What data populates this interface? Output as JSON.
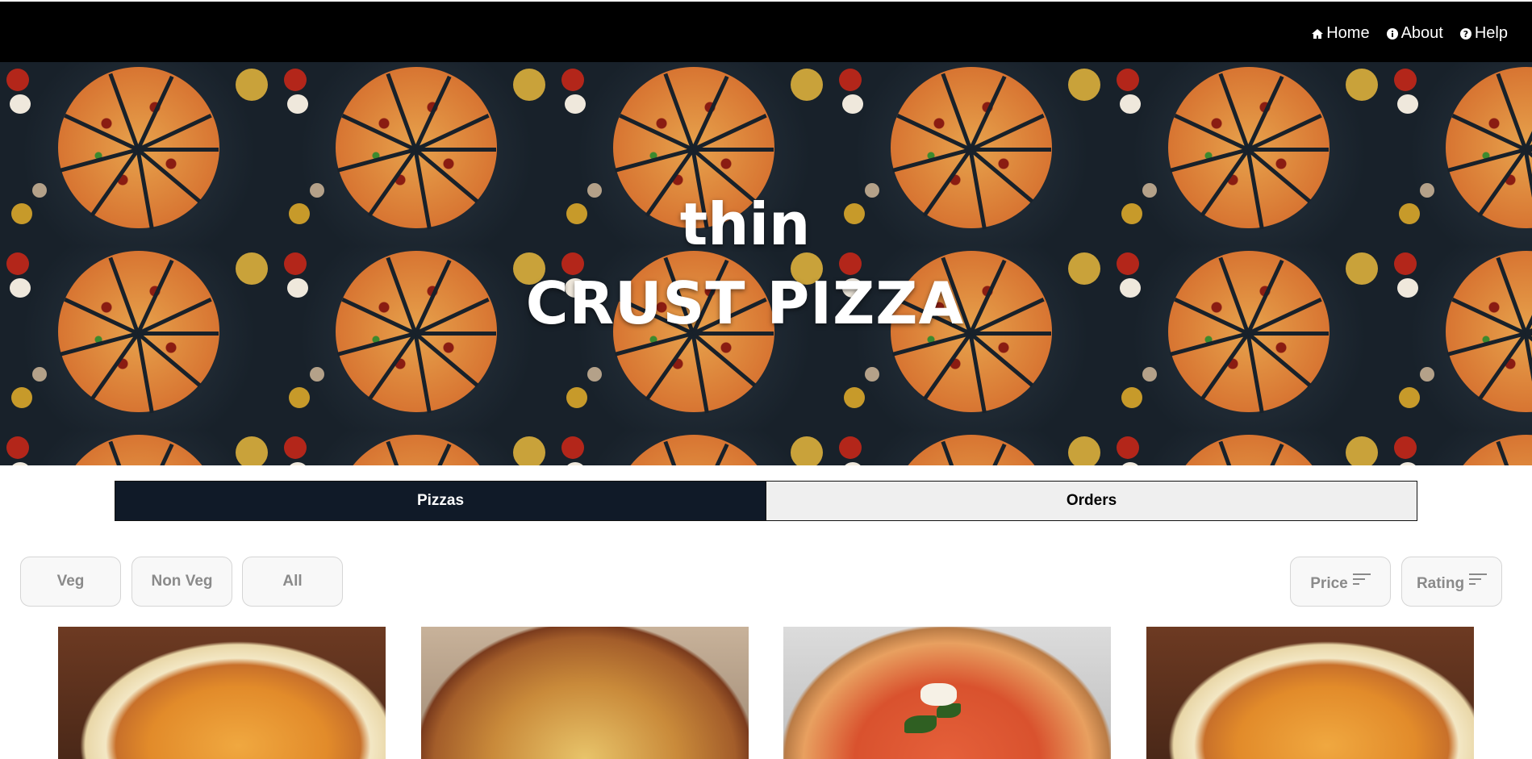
{
  "nav": {
    "links": [
      {
        "label": "Home",
        "icon": "home-icon"
      },
      {
        "label": "About",
        "icon": "info-icon"
      },
      {
        "label": "Help",
        "icon": "help-icon"
      }
    ]
  },
  "hero": {
    "title_line1": "thin",
    "title_line2": "CRUST PIZZA",
    "background": "tiled pizza photo"
  },
  "tabs": [
    {
      "label": "Pizzas",
      "active": true
    },
    {
      "label": "Orders",
      "active": false
    }
  ],
  "filters": {
    "type_buttons": [
      "Veg",
      "Non Veg",
      "All"
    ],
    "sort_buttons": [
      {
        "label": "Price",
        "icon": "sort-icon"
      },
      {
        "label": "Rating",
        "icon": "sort-icon"
      }
    ]
  },
  "colors": {
    "navbar": "#000000",
    "tab_active": "#101a28",
    "tab_inactive": "#efefef",
    "filter_text": "#8a8a8a"
  }
}
